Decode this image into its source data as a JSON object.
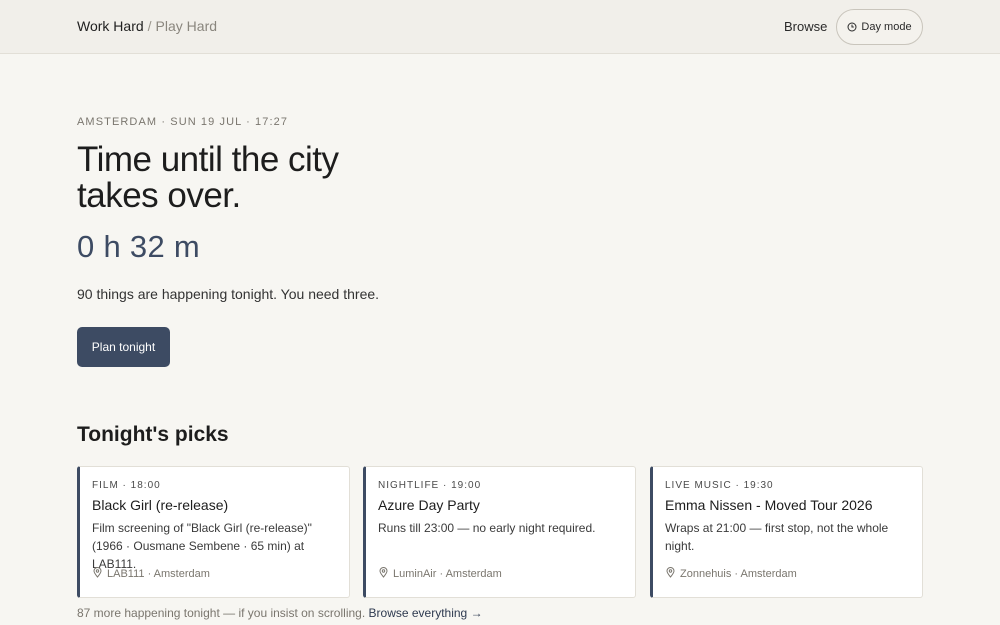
{
  "header": {
    "brand_main": "Work Hard",
    "brand_sep": "/",
    "brand_sub": "Play Hard",
    "browse_label": "Browse",
    "daymode_label": "Day mode",
    "daymode_icon": "clock-icon"
  },
  "hero": {
    "eyebrow": "AMSTERDAM · SUN 19 JUL · 17:27",
    "title": "Time until the city takes over.",
    "countdown": "0 h 32 m",
    "tagline": "90 things are happening tonight. You need three.",
    "cta_label": "Plan tonight"
  },
  "picks": {
    "heading": "Tonight's picks",
    "accent_color": "#3d4b63",
    "cards": [
      {
        "meta": "FILM · 18:00",
        "title": "Black Girl (re-release)",
        "desc": "Film screening of \"Black Girl (re-release)\" (1966 · Ousmane Sembene · 65 min) at LAB111.",
        "location": "LAB111 · Amsterdam"
      },
      {
        "meta": "NIGHTLIFE · 19:00",
        "title": "Azure Day Party",
        "desc": "Runs till 23:00 — no early night required.",
        "location": "LuminAir · Amsterdam"
      },
      {
        "meta": "LIVE MUSIC · 19:30",
        "title": "Emma Nissen - Moved Tour 2026",
        "desc": "Wraps at 21:00 — first stop, not the whole night.",
        "location": "Zonnehuis · Amsterdam"
      }
    ]
  },
  "footer": {
    "note": "87 more happening tonight — if you insist on scrolling.",
    "link_label": "Browse everything →"
  }
}
